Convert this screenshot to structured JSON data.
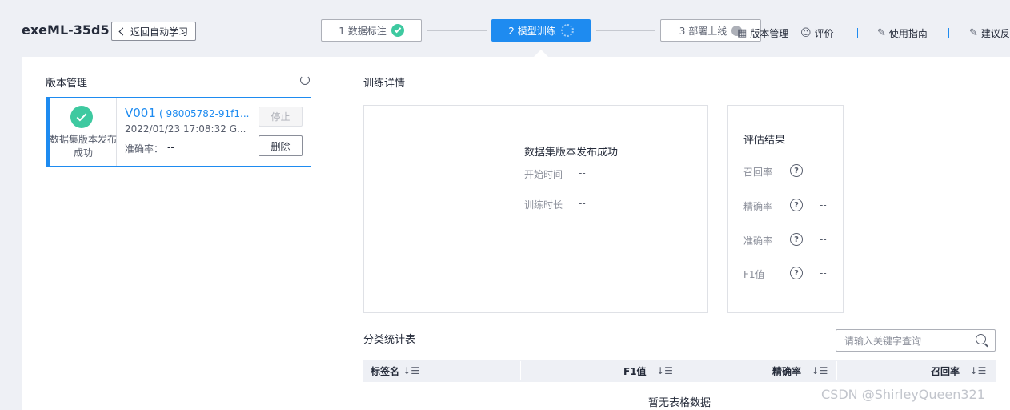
{
  "header": {
    "app_title": "exeML-35d5",
    "back_label": "返回自动学习",
    "steps": [
      {
        "label": "1 数据标注",
        "state": "done"
      },
      {
        "label": "2 模型训练",
        "state": "active"
      },
      {
        "label": "3 部署上线",
        "state": "locked"
      }
    ],
    "links": {
      "version_mgmt": "版本管理",
      "rate": "评价",
      "guide": "使用指南",
      "feedback": "建议反"
    }
  },
  "left": {
    "title": "版本管理",
    "card": {
      "status_text": "数据集版本发布成功",
      "version": "V001",
      "id": "( 98005782-91f1...",
      "date": "2022/01/23 17:08:32 G...",
      "accuracy_label": "准确率：",
      "accuracy_value": "--",
      "stop_label": "停止",
      "delete_label": "删除"
    }
  },
  "training": {
    "title": "训练详情",
    "status": "数据集版本发布成功",
    "start_label": "开始时间",
    "start_value": "--",
    "duration_label": "训练时长",
    "duration_value": "--"
  },
  "eval": {
    "title": "评估结果",
    "help": "?",
    "items": [
      {
        "label": "召回率",
        "value": "--"
      },
      {
        "label": "精确率",
        "value": "--"
      },
      {
        "label": "准确率",
        "value": "--"
      },
      {
        "label": "F1值",
        "value": "--"
      }
    ]
  },
  "class_table": {
    "title": "分类统计表",
    "search_placeholder": "请输入关键字查询",
    "columns": [
      "标签名",
      "F1值",
      "精确率",
      "召回率"
    ],
    "sort_glyph": "↓☰",
    "empty_text": "暂无表格数据"
  },
  "watermark": "CSDN @ShirleyQueen321",
  "colors": {
    "accent": "#1e8bf0",
    "success": "#3ec9a0"
  }
}
